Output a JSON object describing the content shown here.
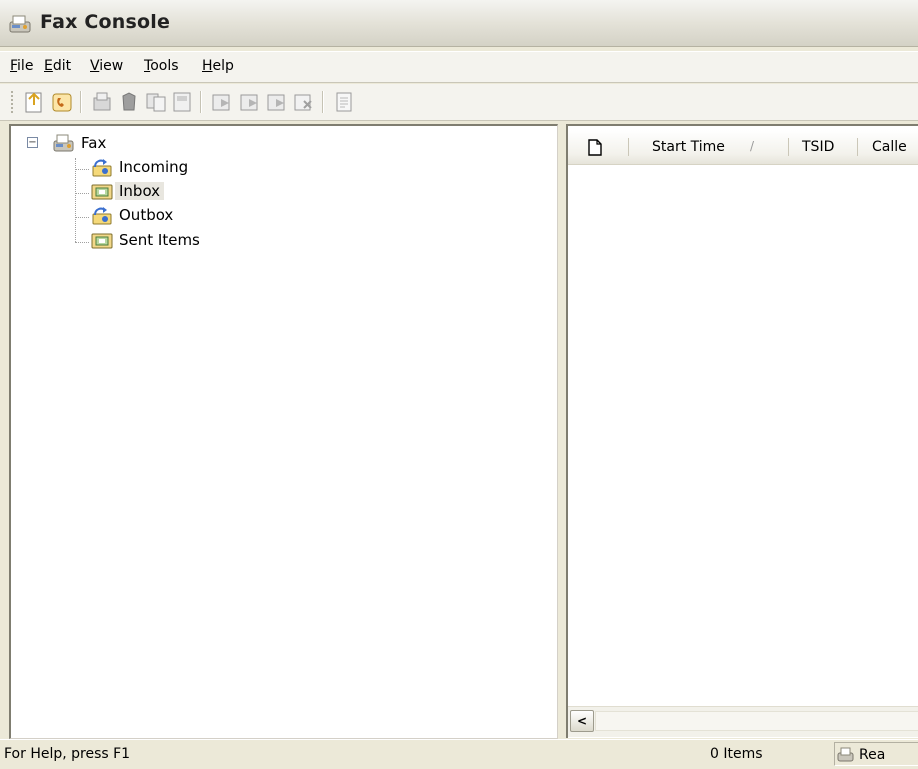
{
  "window": {
    "title": "Fax Console"
  },
  "menu": [
    {
      "label": "File"
    },
    {
      "label": "Edit"
    },
    {
      "label": "View"
    },
    {
      "label": "Tools"
    },
    {
      "label": "Help"
    }
  ],
  "toolbar": {
    "buttons": [
      "send-fax-icon",
      "receive-fax-icon",
      "view-icon",
      "print-icon",
      "copy-icon",
      "save-icon",
      "forward-icon",
      "reply-icon",
      "mail-icon",
      "delete-icon",
      "properties-icon"
    ]
  },
  "tree": {
    "root": {
      "label": "Fax",
      "expander": "−"
    },
    "children": [
      {
        "label": "Incoming",
        "icon": "incoming-folder-icon"
      },
      {
        "label": "Inbox",
        "icon": "inbox-folder-icon",
        "selected": true
      },
      {
        "label": "Outbox",
        "icon": "outbox-folder-icon"
      },
      {
        "label": "Sent Items",
        "icon": "sent-items-folder-icon"
      }
    ]
  },
  "list": {
    "columns": [
      {
        "label": "",
        "icon": "document-icon"
      },
      {
        "label": "Start Time",
        "sort": "/"
      },
      {
        "label": "TSID"
      },
      {
        "label": "Calle"
      }
    ],
    "rows": []
  },
  "scrollbar": {
    "left_arrow": "<"
  },
  "status": {
    "help_text": "For Help, press F1",
    "item_count": "0 Items",
    "state": "Rea"
  },
  "colors": {
    "background": "#ece9d8",
    "pane": "#ffffff",
    "selected_row": "#e8e6df"
  }
}
